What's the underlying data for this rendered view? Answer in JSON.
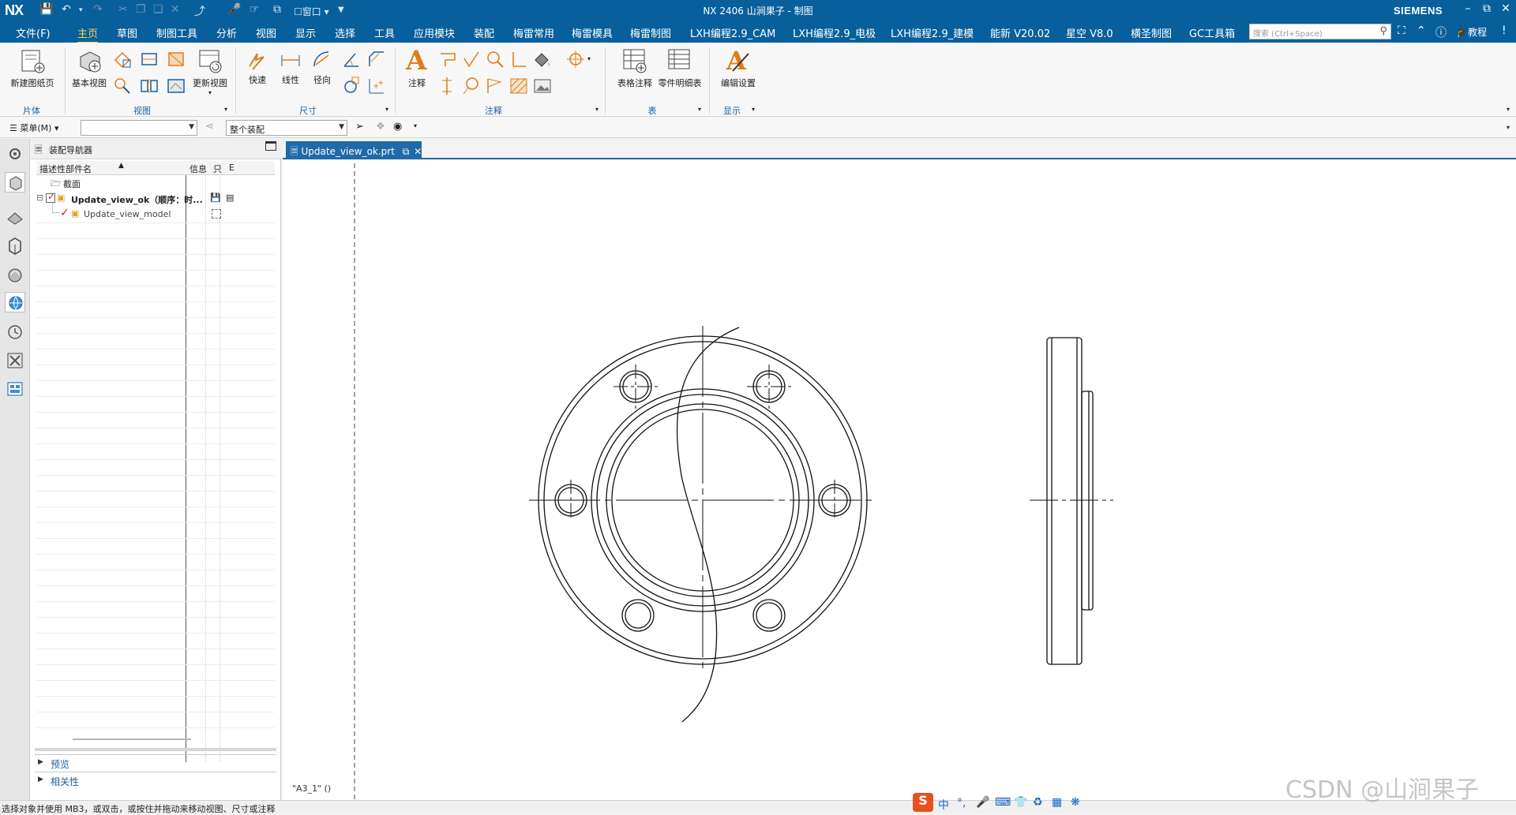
{
  "app": {
    "logo": "NX",
    "window_title": "NX 2406 山涧果子 - 制图",
    "vendor": "SIEMENS",
    "quick_access": {
      "window_label": "窗口"
    }
  },
  "menubar": {
    "items": [
      "文件(F)",
      "主页",
      "草图",
      "制图工具",
      "分析",
      "视图",
      "显示",
      "选择",
      "工具",
      "应用模块",
      "装配",
      "梅雷常用",
      "梅雷模具",
      "梅雷制图",
      "LXH编程2.9_CAM",
      "LXH编程2.9_电极",
      "LXH编程2.9_建模",
      "能新 V20.02",
      "星空 V8.0",
      "横圣制图",
      "GC工具箱"
    ],
    "active": "主页",
    "search_placeholder": "搜索 (Ctrl+Space)",
    "tutorial_label": "教程"
  },
  "ribbon": {
    "groups": [
      {
        "label": "片体",
        "buttons": [
          "新建图纸页"
        ]
      },
      {
        "label": "视图",
        "buttons": [
          "基本视图",
          "更新视图"
        ]
      },
      {
        "label": "尺寸",
        "buttons": [
          "快速",
          "线性",
          "径向"
        ]
      },
      {
        "label": "注释",
        "buttons": [
          "注释"
        ]
      },
      {
        "label": "表",
        "buttons": [
          "表格注释",
          "零件明细表"
        ]
      },
      {
        "label": "显示",
        "buttons": [
          "编辑设置"
        ]
      }
    ]
  },
  "toolbar2": {
    "menu_label": "菜单(M)",
    "filter_value": "",
    "scope_value": "整个装配"
  },
  "navigator": {
    "title": "装配导航器",
    "columns": {
      "name": "描述性部件名",
      "info": "信息",
      "readonly": "只",
      "extra": "E"
    },
    "rows": [
      {
        "label": "截面"
      },
      {
        "label": "Update_view_ok（顺序：时..."
      },
      {
        "label": "Update_view_model"
      }
    ],
    "footer": {
      "preview": "预览",
      "dependency": "相关性"
    }
  },
  "document": {
    "tab_label": "Update_view_ok.prt",
    "sheet_label": "\"A3_1\"  ()"
  },
  "status": {
    "message": "选择对象并使用 MB3，或双击，或按住并拖动来移动视图、尺寸或注释"
  },
  "ime": {
    "items": [
      "中",
      "°,"
    ]
  },
  "watermark": "CSDN @山涧果子",
  "colors": {
    "brand": "#07609c",
    "active_menu": "#ffd34d",
    "tab": "#1f6aa8",
    "icon_orange": "#e07b1a"
  }
}
